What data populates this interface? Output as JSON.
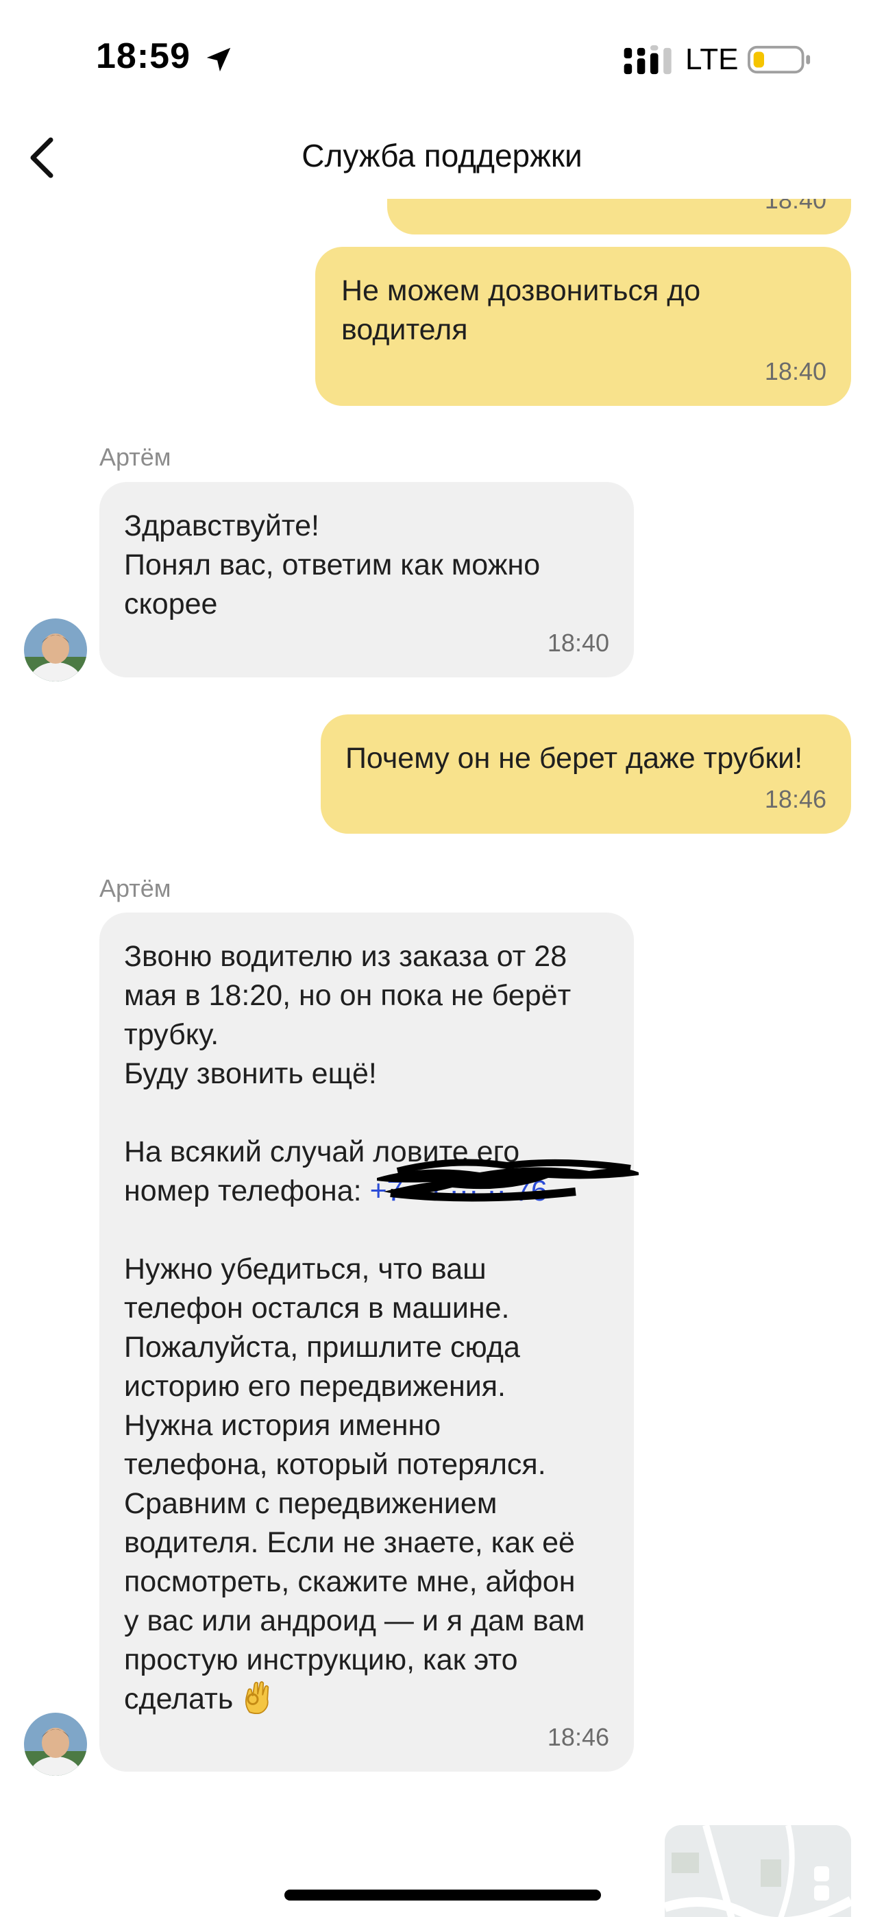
{
  "status_bar": {
    "time": "18:59",
    "network": "LTE",
    "icons": [
      "location-arrow-icon",
      "signal-icon",
      "battery-icon"
    ]
  },
  "header": {
    "title": "Служба поддержки",
    "back_icon": "chevron-left-icon"
  },
  "colors": {
    "outgoing_bubble": "#f8e28c",
    "incoming_bubble": "#f0f0f0",
    "link": "#2a4bd7",
    "time_text": "#6b6b6b"
  },
  "messages": [
    {
      "direction": "outgoing",
      "text": "",
      "time": "18:40",
      "partially_visible": true
    },
    {
      "direction": "outgoing",
      "text": "Не можем дозвониться до\nводителя",
      "time": "18:40"
    },
    {
      "direction": "incoming",
      "sender": "Артём",
      "text": "Здравствуйте!\nПонял вас, ответим как можно\nскорее",
      "time": "18:40"
    },
    {
      "direction": "outgoing",
      "text": "Почему он не берет даже трубки!",
      "time": "18:46"
    },
    {
      "direction": "incoming",
      "sender": "Артём",
      "text_before_link": "Звоню водителю из заказа от 28\nмая в 18:20, но он пока не берёт\nтрубку.\nБуду звонить ещё!\n\nНа всякий случай ловите его\nномер телефона: ",
      "phone_link": "+7 ··· ··· ·· 76",
      "text_after_link": "\n\nНужно убедиться, что ваш\nтелефон остался в машине.\nПожалуйста, пришлите сюда\nисторию его передвижения.\nНужна история именно\nтелефона, который потерялся.\nСравним с передвижением\nводителя. Если не знаете, как её\nпосмотреть, скажите мне, айфон\nу вас или андроид — и я дам вам\nпростую инструкцию, как это\nсделать ",
      "emoji": "ok-hand-emoji",
      "time": "18:46"
    },
    {
      "direction": "outgoing",
      "attachment": "map-screenshot-thumbnail",
      "partially_visible": true
    }
  ]
}
